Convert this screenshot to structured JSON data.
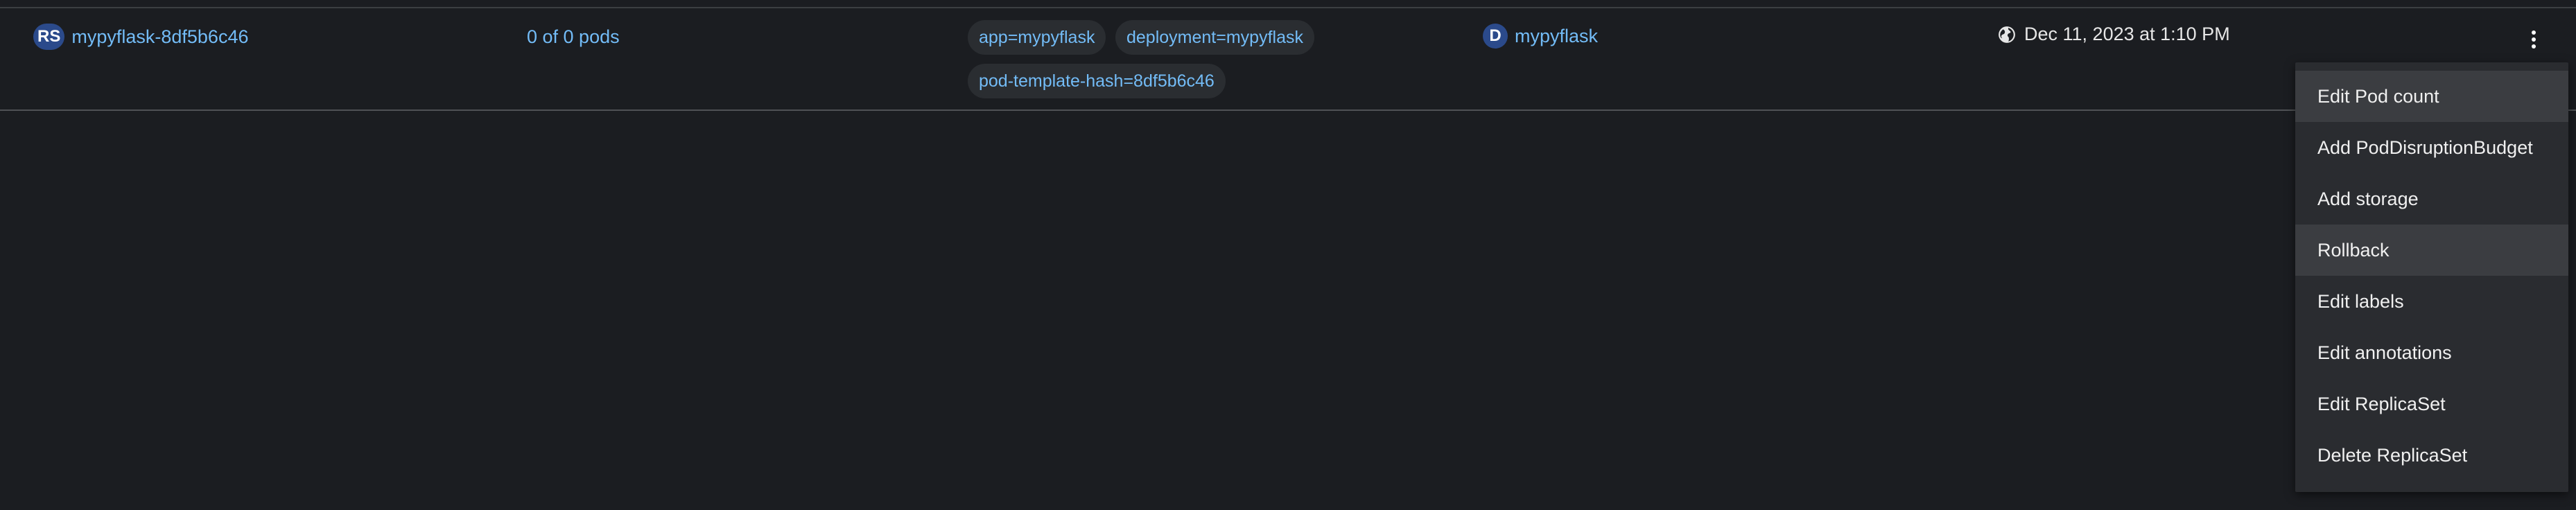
{
  "row": {
    "kind_badge": "RS",
    "name": "mypyflask-8df5b6c46",
    "status": "0 of 0 pods",
    "labels": [
      "app=mypyflask",
      "deployment=mypyflask",
      "pod-template-hash=8df5b6c46"
    ],
    "owner_badge": "D",
    "owner_name": "mypyflask",
    "created_icon": "globe-icon",
    "created": "Dec 11, 2023 at 1:10 PM"
  },
  "actions_menu": {
    "toggle_icon": "kebab-icon",
    "items": [
      "Edit Pod count",
      "Add PodDisruptionBudget",
      "Add storage",
      "Rollback",
      "Edit labels",
      "Edit annotations",
      "Edit ReplicaSet",
      "Delete ReplicaSet"
    ],
    "highlighted": [
      "Edit Pod count",
      "Rollback"
    ]
  },
  "colors": {
    "background": "#1b1d21",
    "link": "#73bcf7",
    "badge": "#2b4a8b",
    "menu_background": "#2a2c30",
    "menu_hover": "#3b3d41"
  }
}
